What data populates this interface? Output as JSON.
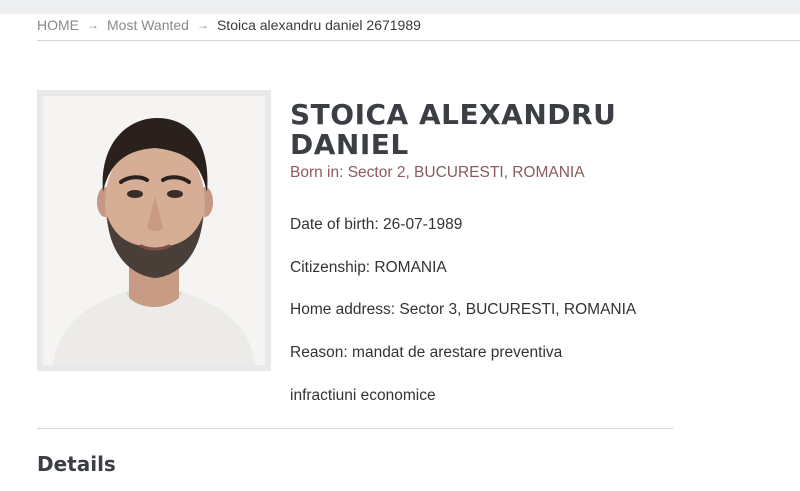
{
  "breadcrumb": {
    "home": "HOME",
    "section": "Most Wanted",
    "current": "Stoica alexandru daniel 2671989"
  },
  "profile": {
    "photo_alt": "Photo of wanted person",
    "name": "STOICA ALEXANDRU DANIEL",
    "born_in": "Born in: Sector 2, BUCURESTI, ROMANIA",
    "date_of_birth": "Date of birth: 26-07-1989",
    "citizenship": "Citizenship: ROMANIA",
    "home_address": "Home address: Sector 3, BUCURESTI, ROMANIA",
    "reason": "Reason: mandat de arestare preventiva",
    "offense": "infractiuni economice"
  },
  "details": {
    "heading": "Details"
  }
}
